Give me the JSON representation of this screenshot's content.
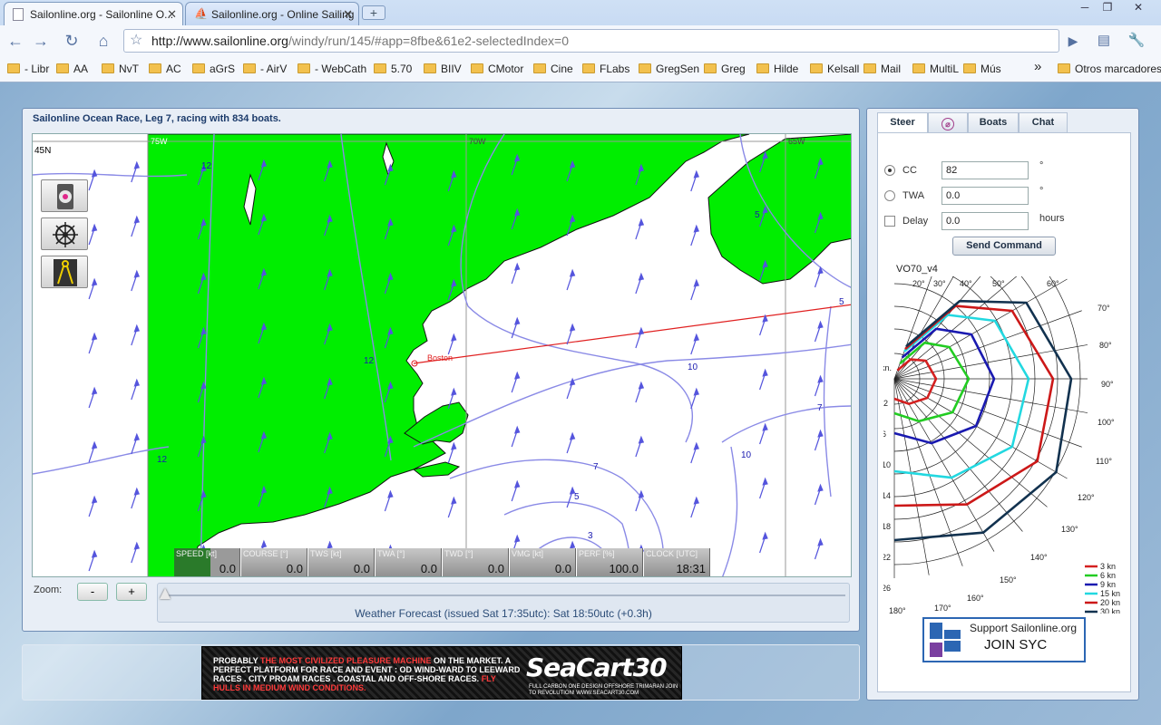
{
  "browser": {
    "tabs": [
      {
        "title": "Sailonline.org - Sailonline O...",
        "active": true
      },
      {
        "title": "Sailonline.org - Online Sailing",
        "active": false
      }
    ],
    "new_tab": "+",
    "url_host": "http://www.sailonline.org",
    "url_path": "/windy/run/145/#app=8fbe&61e2-selectedIndex=0",
    "window_buttons": [
      "─",
      "❐",
      "✕"
    ],
    "bookmarks": [
      "- Libr",
      "AA",
      "NvT",
      "AC",
      "aGrS",
      "- AirV",
      "- WebCath",
      "5.70",
      "BIIV",
      "CMotor",
      "Cine",
      "FLabs",
      "GregSen",
      "Greg",
      "Hilde",
      "Kelsall",
      "Mail",
      "MultiL",
      "Mús"
    ],
    "bookmarks_overflow": "»",
    "other_bookmarks": "Otros marcadores"
  },
  "race": {
    "title": "Sailonline Ocean Race, Leg 7, racing with 834 boats."
  },
  "map": {
    "lat_label": "45N",
    "lon_labels": [
      "75W",
      "70W",
      "65W"
    ],
    "place": "Boston",
    "contour_labels": [
      "12",
      "12",
      "12",
      "5",
      "5",
      "10",
      "7",
      "10",
      "7",
      "5",
      "3"
    ],
    "land_color": "#00ee00",
    "wind_color": "#6a6ae8"
  },
  "tools": [
    "compass-tool",
    "helm-tool",
    "divider-tool"
  ],
  "instruments": [
    {
      "label": "SPEED [kt]",
      "value": "0.0"
    },
    {
      "label": "COURSE [°]",
      "value": "0.0"
    },
    {
      "label": "TWS [kt]",
      "value": "0.0"
    },
    {
      "label": "TWA [°]",
      "value": "0.0"
    },
    {
      "label": "TWD [°]",
      "value": "0.0"
    },
    {
      "label": "VMG [kt]",
      "value": "0.0"
    },
    {
      "label": "PERF [%]",
      "value": "100.0"
    },
    {
      "label": "CLOCK [UTC]",
      "value": "18:31"
    }
  ],
  "zoom": {
    "label": "Zoom:",
    "minus": "-",
    "plus": "+",
    "forecast": "Weather Forecast  (issued Sat 17:35utc): Sat 18:50utc  (+0.3h)",
    "position": 0
  },
  "ad": {
    "line1": "PROBABLY ",
    "hl1": "THE MOST CIVILIZED PLEASURE MACHINE",
    "line2": " ON THE MARKET. A PERFECT PLATFORM FOR RACE AND EVENT : OD WIND-WARD TO LEEWARD RACES . CITY PROAM RACES . COASTAL AND OFF-SHORE RACES. ",
    "hl2": "FLY HULLS IN MEDIUM WIND CONDITIONS.",
    "brand": "SeaCart30",
    "sub": "FULL CARBON ONE DESIGN OFFSHORE TRIMARAN Join to Revolution! www.SeaCart30.com"
  },
  "steer": {
    "tabs": [
      "Steer",
      "",
      "Boats",
      "Chat"
    ],
    "cc_label": "CC",
    "cc_value": "82",
    "twa_label": "TWA",
    "twa_value": "0.0",
    "delay_label": "Delay",
    "delay_value": "0.0",
    "deg_unit": "°",
    "hours_unit": "hours",
    "send": "Send Command",
    "selected_mode": "CC"
  },
  "polar": {
    "title": "VO70_v4",
    "speed_unit": "kn.",
    "speed_labels": [
      "2",
      "6",
      "10",
      "14",
      "18",
      "22",
      "26"
    ],
    "top_angles": [
      "20°",
      "30°",
      "40°",
      "50°",
      "60°"
    ],
    "right_angles": [
      "70°",
      "80°",
      "90°",
      "100°",
      "110°",
      "120°",
      "130°",
      "140°",
      "150°",
      "160°",
      "170°",
      "180°"
    ],
    "legend": [
      {
        "label": "3 kn",
        "color": "#d42020"
      },
      {
        "label": "6 kn",
        "color": "#22cc22"
      },
      {
        "label": "9 kn",
        "color": "#1a1ab0"
      },
      {
        "label": "15 kn",
        "color": "#22d8e0"
      },
      {
        "label": "20 kn",
        "color": "#cc1818"
      },
      {
        "label": "30 kn",
        "color": "#12324f"
      }
    ]
  },
  "support": {
    "line1": "Support Sailonline.org",
    "line2": "JOIN SYC"
  }
}
